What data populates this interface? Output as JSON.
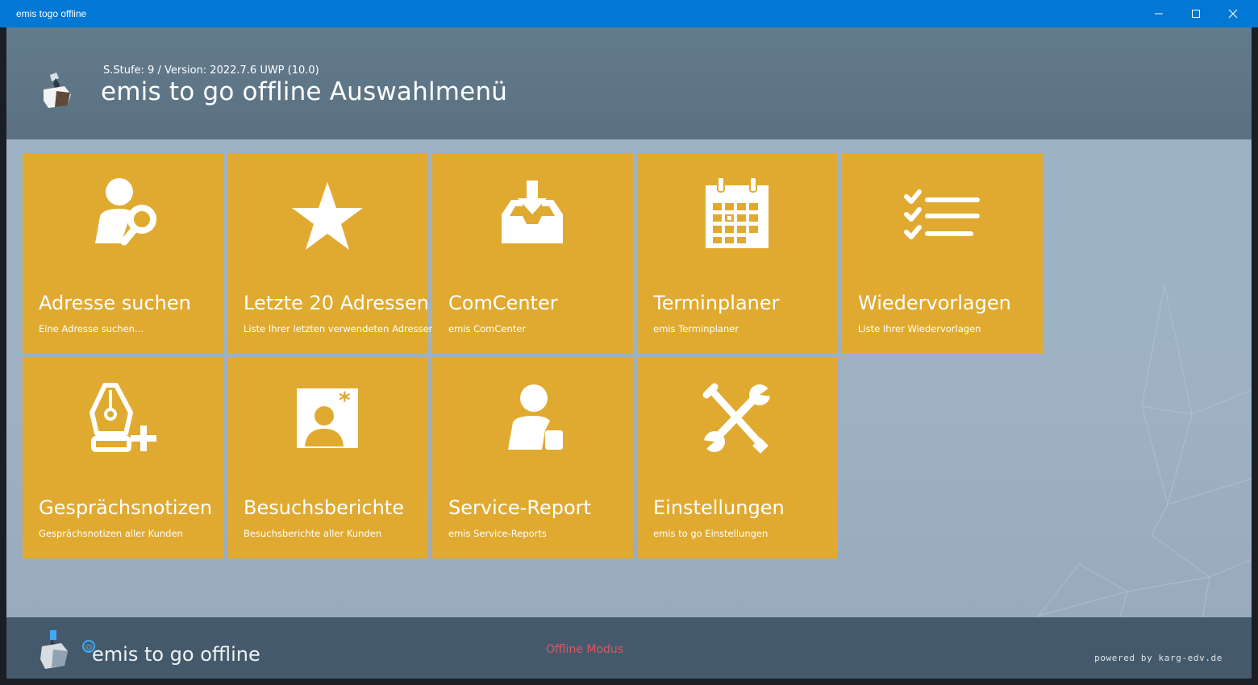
{
  "window": {
    "title": "emis togo offline",
    "controls": [
      "minimize-icon",
      "maximize-icon",
      "close-icon"
    ]
  },
  "header": {
    "version": "S.Stufe: 9 / Version: 2022.7.6 UWP (10.0)",
    "title": "emis to go offline Auswahlmenü"
  },
  "tiles": [
    {
      "title": "Adresse suchen",
      "subtitle": "Eine Adresse suchen...",
      "icon": "person-search-icon"
    },
    {
      "title": "Letzte 20 Adressen",
      "subtitle": "Liste Ihrer letzten verwendeten Adressen",
      "icon": "star-icon"
    },
    {
      "title": "ComCenter",
      "subtitle": "emis ComCenter",
      "icon": "inbox-download-icon"
    },
    {
      "title": "Terminplaner",
      "subtitle": "emis Terminplaner",
      "icon": "calendar-icon"
    },
    {
      "title": "Wiedervorlagen",
      "subtitle": "Liste Ihrer Wiedervorlagen",
      "icon": "checklist-icon"
    },
    {
      "title": "Gesprächsnotizen",
      "subtitle": "Gesprächsnotizen aller Kunden",
      "icon": "pen-add-icon"
    },
    {
      "title": "Besuchsberichte",
      "subtitle": "Besuchsberichte aller Kunden",
      "icon": "contact-card-icon"
    },
    {
      "title": "Service-Report",
      "subtitle": "emis Service-Reports",
      "icon": "person-report-icon"
    },
    {
      "title": "Einstellungen",
      "subtitle": "emis to go Einstellungen",
      "icon": "tools-icon"
    }
  ],
  "footer": {
    "brand": "emis to go offline",
    "mode": "Offline Modus",
    "powered": "powered by karg-edv.de"
  },
  "colors": {
    "titlebar": "#0078d4",
    "tile": "#e0aa30",
    "header": "#5f7686",
    "footer": "#445a6c",
    "mode_text": "#e0555f"
  }
}
